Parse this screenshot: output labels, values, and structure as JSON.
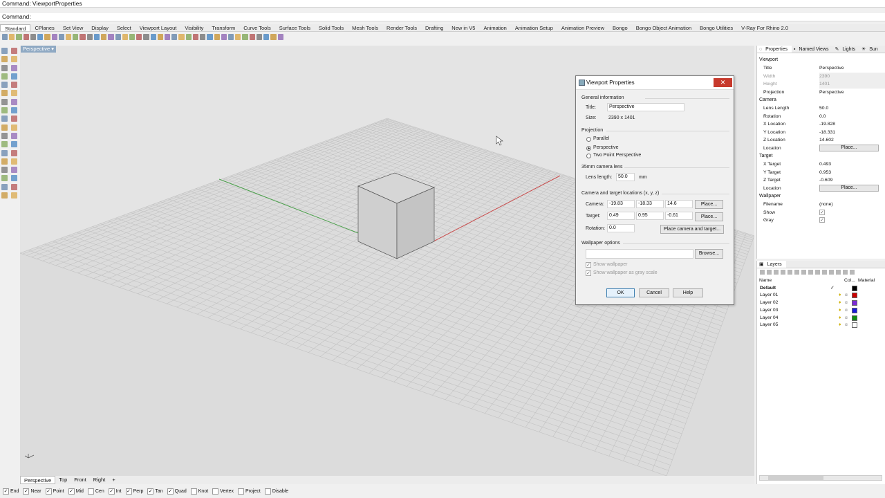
{
  "command_history": "Command: ViewportProperties",
  "command_prompt": "Command:",
  "toolbar_tabs": [
    "Standard",
    "CPlanes",
    "Set View",
    "Display",
    "Select",
    "Viewport Layout",
    "Visibility",
    "Transform",
    "Curve Tools",
    "Surface Tools",
    "Solid Tools",
    "Mesh Tools",
    "Render Tools",
    "Drafting",
    "New in V5",
    "Animation",
    "Animation Setup",
    "Animation Preview",
    "Bongo",
    "Bongo Object Animation",
    "Bongo Utilities",
    "V-Ray For Rhino 2.0"
  ],
  "viewport_label": "Perspective",
  "dialog": {
    "title": "Viewport Properties",
    "close": "✕",
    "general_header": "General information",
    "title_label": "Title:",
    "title_value": "Perspective",
    "size_label": "Size:",
    "size_value": "2390 x 1401",
    "projection_header": "Projection",
    "proj_parallel": "Parallel",
    "proj_perspective": "Perspective",
    "proj_two_point": "Two Point Perspective",
    "lens_header": "35mm camera lens",
    "lens_label": "Lens length:",
    "lens_value": "50.0",
    "lens_unit": "mm",
    "locations_header": "Camera and target locations (x, y, z)",
    "camera_label": "Camera:",
    "camera_x": "-19.83",
    "camera_y": "-18.33",
    "camera_z": "14.6",
    "target_label": "Target:",
    "target_x": "0.49",
    "target_y": "0.95",
    "target_z": "-0.61",
    "rotation_label": "Rotation:",
    "rotation_value": "0.0",
    "place_btn": "Place...",
    "place_ct_btn": "Place camera and target...",
    "wallpaper_header": "Wallpaper options",
    "browse_btn": "Browse...",
    "show_wallpaper": "Show wallpaper",
    "show_gray": "Show wallpaper as gray scale",
    "ok": "OK",
    "cancel": "Cancel",
    "help": "Help"
  },
  "props_panel": {
    "tabs": [
      "Properties",
      "Named Views",
      "Lights",
      "Sun"
    ],
    "viewport_group": "Viewport",
    "rows_viewport": [
      {
        "k": "Title",
        "v": "Perspective"
      },
      {
        "k": "Width",
        "v": "2390"
      },
      {
        "k": "Height",
        "v": "1401"
      },
      {
        "k": "Projection",
        "v": "Perspective"
      }
    ],
    "camera_group": "Camera",
    "rows_camera": [
      {
        "k": "Lens Length",
        "v": "50.0"
      },
      {
        "k": "Rotation",
        "v": "0.0"
      },
      {
        "k": "X Location",
        "v": "-19.828"
      },
      {
        "k": "Y Location",
        "v": "-18.331"
      },
      {
        "k": "Z Location",
        "v": "14.602"
      }
    ],
    "location_label": "Location",
    "place_btn": "Place...",
    "target_group": "Target",
    "rows_target": [
      {
        "k": "X Target",
        "v": "0.493"
      },
      {
        "k": "Y Target",
        "v": "0.953"
      },
      {
        "k": "Z Target",
        "v": "-0.609"
      }
    ],
    "wallpaper_group": "Wallpaper",
    "filename_label": "Filename",
    "filename_value": "(none)",
    "show_label": "Show",
    "gray_label": "Gray"
  },
  "layers_panel": {
    "title": "Layers",
    "col_name": "Name",
    "col_color": "Col...",
    "col_material": "Material",
    "layers": [
      {
        "name": "Default",
        "color": "#000000",
        "current": "✓"
      },
      {
        "name": "Layer 01",
        "color": "#cc0000",
        "current": ""
      },
      {
        "name": "Layer 02",
        "color": "#7b2bd6",
        "current": ""
      },
      {
        "name": "Layer 03",
        "color": "#1a1adb",
        "current": ""
      },
      {
        "name": "Layer 04",
        "color": "#118a11",
        "current": ""
      },
      {
        "name": "Layer 05",
        "color": "#ffffff",
        "current": ""
      }
    ]
  },
  "view_tabs": [
    "Perspective",
    "Top",
    "Front",
    "Right",
    "+"
  ],
  "osnaps": [
    {
      "label": "End",
      "on": true
    },
    {
      "label": "Near",
      "on": true
    },
    {
      "label": "Point",
      "on": true
    },
    {
      "label": "Mid",
      "on": true
    },
    {
      "label": "Cen",
      "on": false
    },
    {
      "label": "Int",
      "on": true
    },
    {
      "label": "Perp",
      "on": true
    },
    {
      "label": "Tan",
      "on": true
    },
    {
      "label": "Quad",
      "on": true
    },
    {
      "label": "Knot",
      "on": false
    },
    {
      "label": "Vertex",
      "on": false
    },
    {
      "label": "Project",
      "on": false
    },
    {
      "label": "Disable",
      "on": false
    }
  ]
}
